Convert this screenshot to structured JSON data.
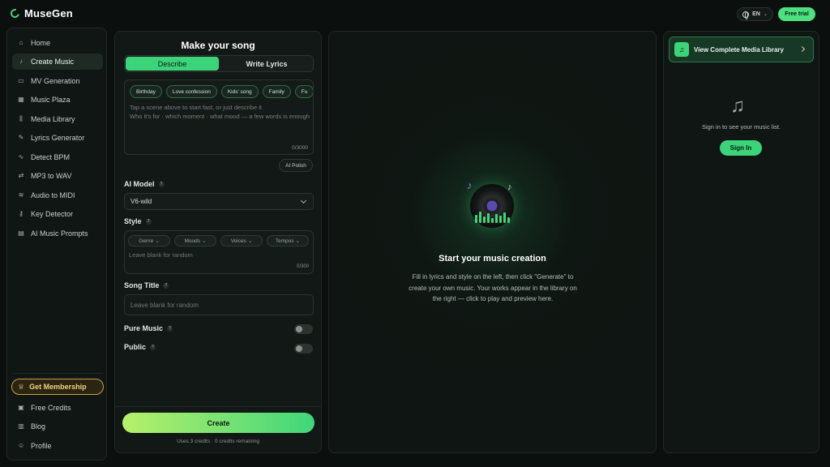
{
  "app": {
    "name": "MuseGen"
  },
  "header": {
    "lang": "EN",
    "free_trial": "Free trial"
  },
  "sidebar": {
    "items": [
      {
        "label": "Home",
        "icon": "home-icon",
        "active": false
      },
      {
        "label": "Create Music",
        "icon": "music-note-icon",
        "active": true
      },
      {
        "label": "MV Generation",
        "icon": "video-icon",
        "active": false
      },
      {
        "label": "Music Plaza",
        "icon": "grid-icon",
        "active": false
      },
      {
        "label": "Media Library",
        "icon": "library-icon",
        "active": false
      },
      {
        "label": "Lyrics Generator",
        "icon": "pen-icon",
        "active": false
      },
      {
        "label": "Detect BPM",
        "icon": "pulse-icon",
        "active": false
      },
      {
        "label": "MP3 to WAV",
        "icon": "convert-icon",
        "active": false
      },
      {
        "label": "Audio to MIDI",
        "icon": "waveform-icon",
        "active": false
      },
      {
        "label": "Key Detector",
        "icon": "key-icon",
        "active": false
      },
      {
        "label": "AI Music Prompts",
        "icon": "prompt-icon",
        "active": false
      }
    ],
    "membership": "Get Membership",
    "bottom_items": [
      {
        "label": "Free Credits",
        "icon": "credits-icon"
      },
      {
        "label": "Blog",
        "icon": "blog-icon"
      },
      {
        "label": "Profile",
        "icon": "user-icon"
      }
    ]
  },
  "form": {
    "title": "Make your song",
    "tabs": [
      "Describe",
      "Write Lyrics"
    ],
    "chips": [
      "Birthday",
      "Love confession",
      "Kids' song",
      "Family",
      "Fu"
    ],
    "description_placeholder_1": "Tap a scene above to start fast, or just describe it",
    "description_placeholder_2": "Who it's for · which moment · what mood — a few words is enough",
    "description_count": "0/3000",
    "ai_polish": "AI Polish",
    "ai_model_label": "AI Model",
    "ai_model_value": "V6-wild",
    "style_label": "Style",
    "style_tags": [
      "Genre",
      "Moods",
      "Voices",
      "Tempos"
    ],
    "style_placeholder": "Leave blank for random",
    "style_count": "0/300",
    "song_title_label": "Song Title",
    "song_title_placeholder": "Leave blank for random",
    "pure_music_label": "Pure Music",
    "public_label": "Public",
    "create_label": "Create",
    "credits_text": "Uses 3 credits · 0 credits remaining"
  },
  "center": {
    "title": "Start your music creation",
    "description": "Fill in lyrics and style on the left, then click \"Generate\" to create your own music. Your works appear in the library on the right — click to play and preview here."
  },
  "right": {
    "library_button": "View Complete Media Library",
    "signin_text": "Sign in to see your music list.",
    "signin_button": "Sign In"
  },
  "colors": {
    "accent": "#3cd479",
    "background": "#0b100e",
    "membership": "#c9a240"
  }
}
